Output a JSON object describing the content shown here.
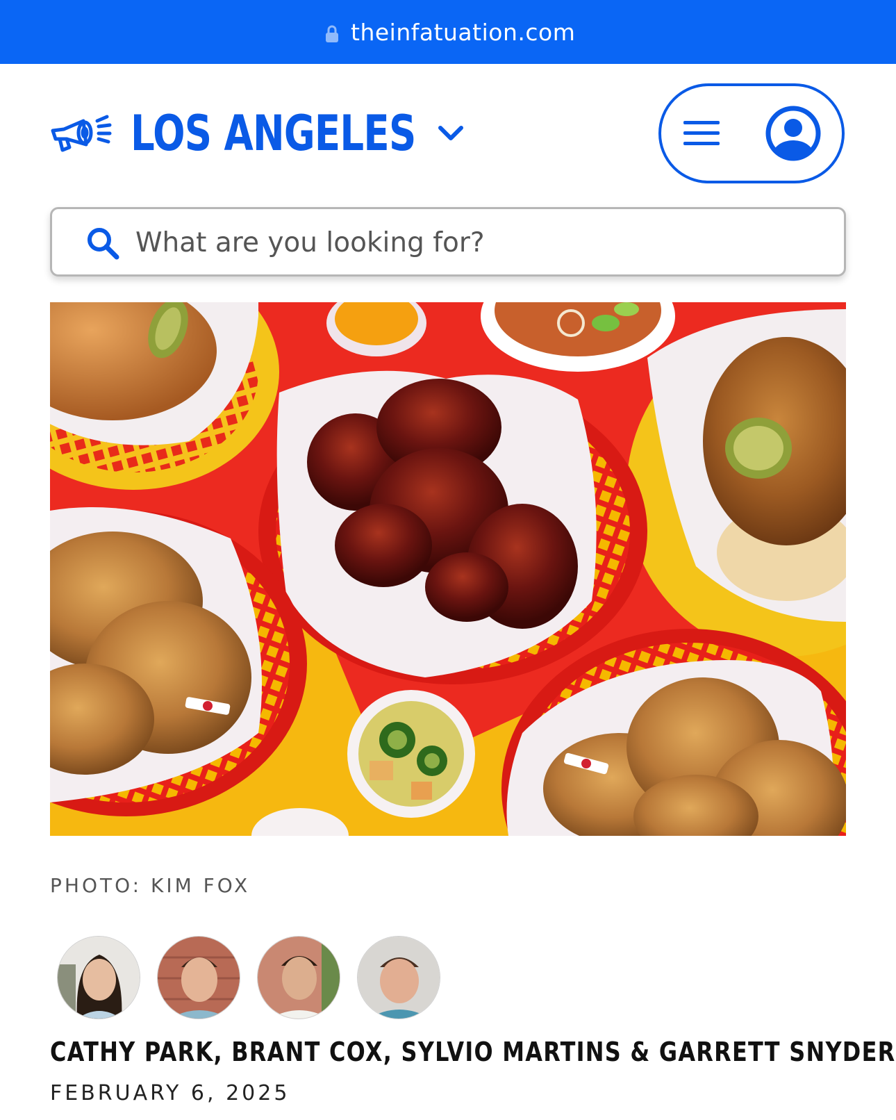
{
  "browser": {
    "url": "theinfatuation.com",
    "lock_icon": "lock-icon",
    "bar_color": "#0a66f5"
  },
  "header": {
    "city": "LOS ANGELES",
    "logo_icon": "megaphone-icon",
    "city_dropdown_icon": "chevron-down-icon",
    "menu_icon": "hamburger-icon",
    "account_icon": "user-circle-icon",
    "brand_color": "#0a5ae6"
  },
  "search": {
    "placeholder": "What are you looking for?",
    "value": "",
    "icon": "search-icon"
  },
  "hero": {
    "caption": "PHOTO: KIM FOX"
  },
  "byline": {
    "authors": "CATHY PARK, BRANT COX, SYLVIO MARTINS & GARRETT SNYDER",
    "date": "FEBRUARY 6, 2025"
  }
}
